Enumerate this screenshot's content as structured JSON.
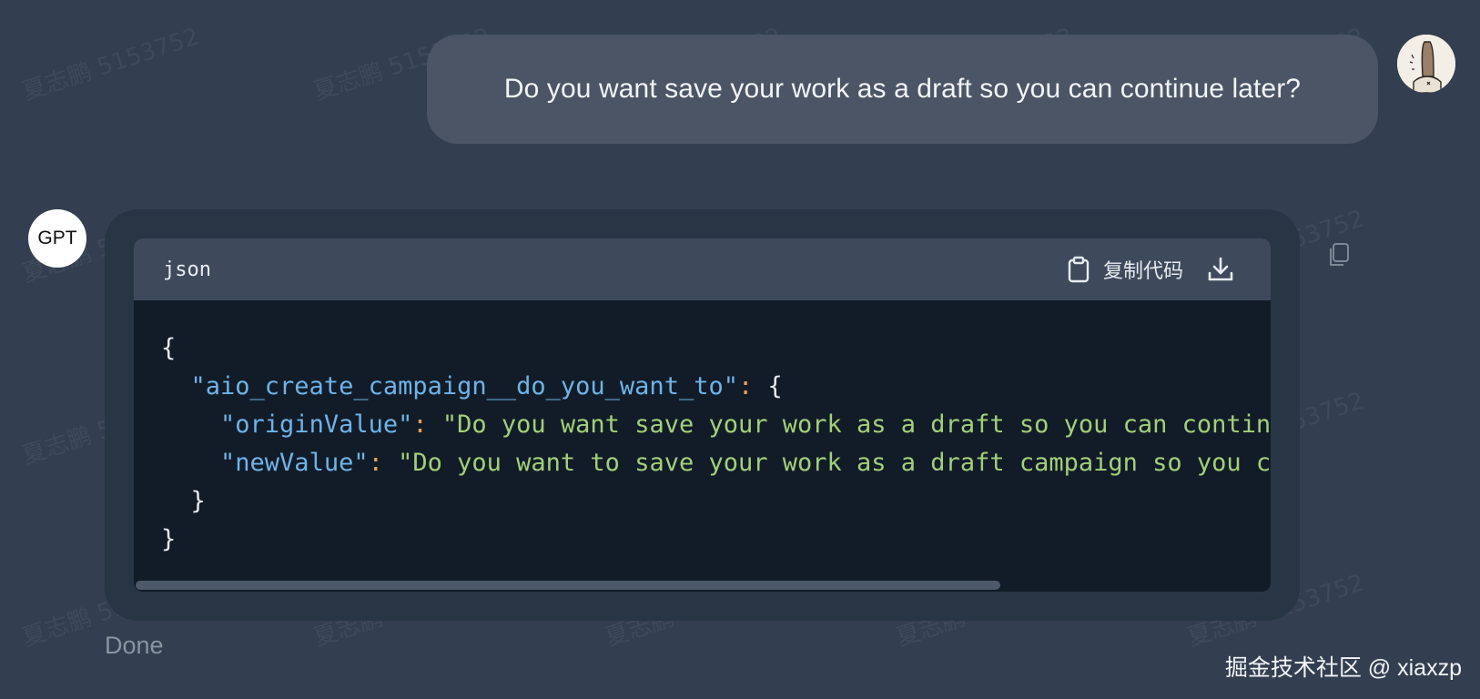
{
  "watermark": {
    "text": "夏志鹏 5153752"
  },
  "user_message": {
    "text": "Do you want save your work as a draft so you can continue later?",
    "avatar_icon": "user-avatar-drawing"
  },
  "assistant": {
    "avatar_label": "GPT",
    "code_block": {
      "language": "json",
      "copy_label": "复制代码",
      "copy_icon": "clipboard-icon",
      "download_icon": "download-icon",
      "lines": {
        "l1": "{",
        "l2_indent": "  ",
        "l2_key": "\"aio_create_campaign__do_you_want_to\"",
        "l2_colon": ": ",
        "l2_open": "{",
        "l3_indent": "    ",
        "l3_key": "\"originValue\"",
        "l3_colon": ": ",
        "l3_value": "\"Do you want save your work as a draft so you can continue later?\",",
        "l4_indent": "    ",
        "l4_key": "\"newValue\"",
        "l4_colon": ": ",
        "l4_value": "\"Do you want to save your work as a draft campaign so you can continue later?\"",
        "l5": "  }",
        "l6": "}"
      }
    },
    "side_copy_icon": "copy-icon",
    "status": "Done"
  },
  "footer": {
    "credit": "掘金技术社区 @ xiaxzp"
  },
  "colors": {
    "background": "#333f50",
    "user_bubble": "#4b5565",
    "assistant_bubble": "#283545",
    "code_header": "#3e4a5b",
    "code_body": "#121c28",
    "json_key": "#6fb3e8",
    "json_string": "#a4cf7a",
    "json_colon": "#e4a05a"
  }
}
